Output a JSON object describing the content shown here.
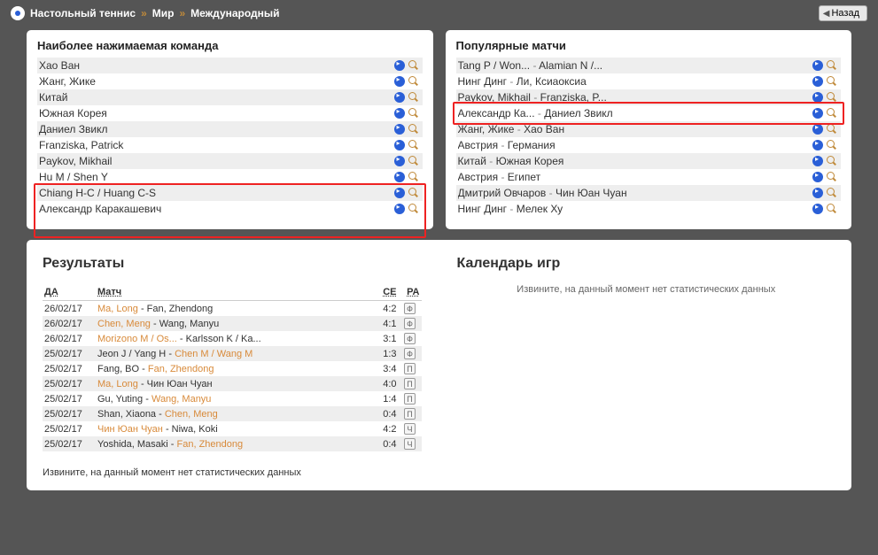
{
  "breadcrumb": {
    "sport": "Настольный теннис",
    "region": "Мир",
    "league": "Международный"
  },
  "back_label": "Назад",
  "teams_panel": {
    "title": "Наиболее нажимаемая команда",
    "items": [
      {
        "name": "Хао Ван"
      },
      {
        "name": "Жанг, Жике"
      },
      {
        "name": "Китай"
      },
      {
        "name": "Южная Корея"
      },
      {
        "name": "Даниел Звикл"
      },
      {
        "name": "Franziska, Patrick"
      },
      {
        "name": "Paykov, Mikhail"
      },
      {
        "name": "Hu M / Shen Y"
      },
      {
        "name": "Chiang H-C / Huang C-S"
      },
      {
        "name": "Александр Каракашевич"
      }
    ]
  },
  "matches_panel": {
    "title": "Популярные матчи",
    "items": [
      {
        "a": "Tang P / Won...",
        "b": "Alamian N /..."
      },
      {
        "a": "Нинг Динг",
        "b": "Ли, Ксиаоксиа"
      },
      {
        "a": "Paykov, Mikhail",
        "b": "Franziska, P..."
      },
      {
        "a": "Александр Ка...",
        "b": "Даниел Звикл"
      },
      {
        "a": "Жанг, Жике",
        "b": "Хао Ван"
      },
      {
        "a": "Австрия",
        "b": "Германия"
      },
      {
        "a": "Китай",
        "b": "Южная Корея"
      },
      {
        "a": "Австрия",
        "b": "Египет"
      },
      {
        "a": "Дмитрий Овчаров",
        "b": "Чин Юан Чуан"
      },
      {
        "a": "Нинг Динг",
        "b": "Мелек Ху"
      }
    ]
  },
  "results": {
    "title": "Результаты",
    "headers": {
      "date": "ДА",
      "match": "Матч",
      "score": "СЕ",
      "ra": "РА"
    },
    "rows": [
      {
        "date": "26/02/17",
        "a": "Ma, Long",
        "b": "Fan, Zhendong",
        "w": "a",
        "score": "4:2",
        "ra": "Ф"
      },
      {
        "date": "26/02/17",
        "a": "Chen, Meng",
        "b": "Wang, Manyu",
        "w": "a",
        "score": "4:1",
        "ra": "Ф"
      },
      {
        "date": "26/02/17",
        "a": "Morizono M / Os...",
        "b": "Karlsson K / Ka...",
        "w": "a",
        "score": "3:1",
        "ra": "Ф"
      },
      {
        "date": "25/02/17",
        "a": "Jeon J / Yang H",
        "b": "Chen M / Wang M",
        "w": "b",
        "score": "1:3",
        "ra": "Ф"
      },
      {
        "date": "25/02/17",
        "a": "Fang, BO",
        "b": "Fan, Zhendong",
        "w": "b",
        "score": "3:4",
        "ra": "П"
      },
      {
        "date": "25/02/17",
        "a": "Ma, Long",
        "b": "Чин Юан Чуан",
        "w": "a",
        "score": "4:0",
        "ra": "П"
      },
      {
        "date": "25/02/17",
        "a": "Gu, Yuting",
        "b": "Wang, Manyu",
        "w": "b",
        "score": "1:4",
        "ra": "П"
      },
      {
        "date": "25/02/17",
        "a": "Shan, Xiaona",
        "b": "Chen, Meng",
        "w": "b",
        "score": "0:4",
        "ra": "П"
      },
      {
        "date": "25/02/17",
        "a": "Чин Юан Чуан",
        "b": "Niwa, Koki",
        "w": "a",
        "score": "4:2",
        "ra": "Ч"
      },
      {
        "date": "25/02/17",
        "a": "Yoshida, Masaki",
        "b": "Fan, Zhendong",
        "w": "b",
        "score": "0:4",
        "ra": "Ч"
      }
    ]
  },
  "calendar": {
    "title": "Календарь игр",
    "empty": "Извините, на данный момент нет статистических данных"
  },
  "bottom_note": "Извините, на данный момент нет статистических данных"
}
